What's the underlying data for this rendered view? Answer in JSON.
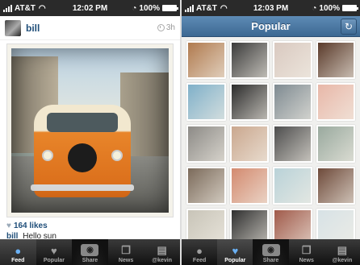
{
  "left_screen": {
    "status": {
      "carrier": "AT&T",
      "time": "12:02 PM",
      "battery": "100%"
    },
    "post": {
      "username": "bill",
      "time_ago": "3h",
      "likes": "164 likes",
      "caption_user": "bill",
      "caption_text": "Hello sun"
    },
    "tabs": [
      {
        "label": "Feed",
        "icon": "person-icon",
        "active": true
      },
      {
        "label": "Popular",
        "icon": "heart-icon",
        "active": false
      },
      {
        "label": "Share",
        "icon": "camera-icon",
        "active": false
      },
      {
        "label": "News",
        "icon": "news-icon",
        "active": false
      },
      {
        "label": "@kevin",
        "icon": "profile-card-icon",
        "active": false
      }
    ]
  },
  "right_screen": {
    "status": {
      "carrier": "AT&T",
      "time": "12:03 PM",
      "battery": "100%"
    },
    "nav_title": "Popular",
    "tabs": [
      {
        "label": "Feed",
        "icon": "person-icon",
        "active": false
      },
      {
        "label": "Popular",
        "icon": "heart-icon",
        "active": true
      },
      {
        "label": "Share",
        "icon": "camera-icon",
        "active": false
      },
      {
        "label": "News",
        "icon": "news-icon",
        "active": false
      },
      {
        "label": "@kevin",
        "icon": "profile-card-icon",
        "active": false
      }
    ]
  },
  "colors": {
    "accent": "#1f4e79",
    "nav_bar": "#4a78a4",
    "tab_active_icon": "#6ab0f3",
    "thumbs": [
      "#b07a4e",
      "#3b3b3b",
      "#d9c9c0",
      "#5a3a2a",
      "#7fb0c9",
      "#2b2b2b",
      "#7e8a91",
      "#e8b7a8",
      "#8c8a86",
      "#caa78e",
      "#4d4d4d",
      "#99a99e",
      "#7b6a5a",
      "#d38a6f",
      "#b9d2d8",
      "#6e4a3a",
      "#c8c4b8",
      "#2f2f2f",
      "#a05a4a",
      "#d7e2e6"
    ]
  }
}
